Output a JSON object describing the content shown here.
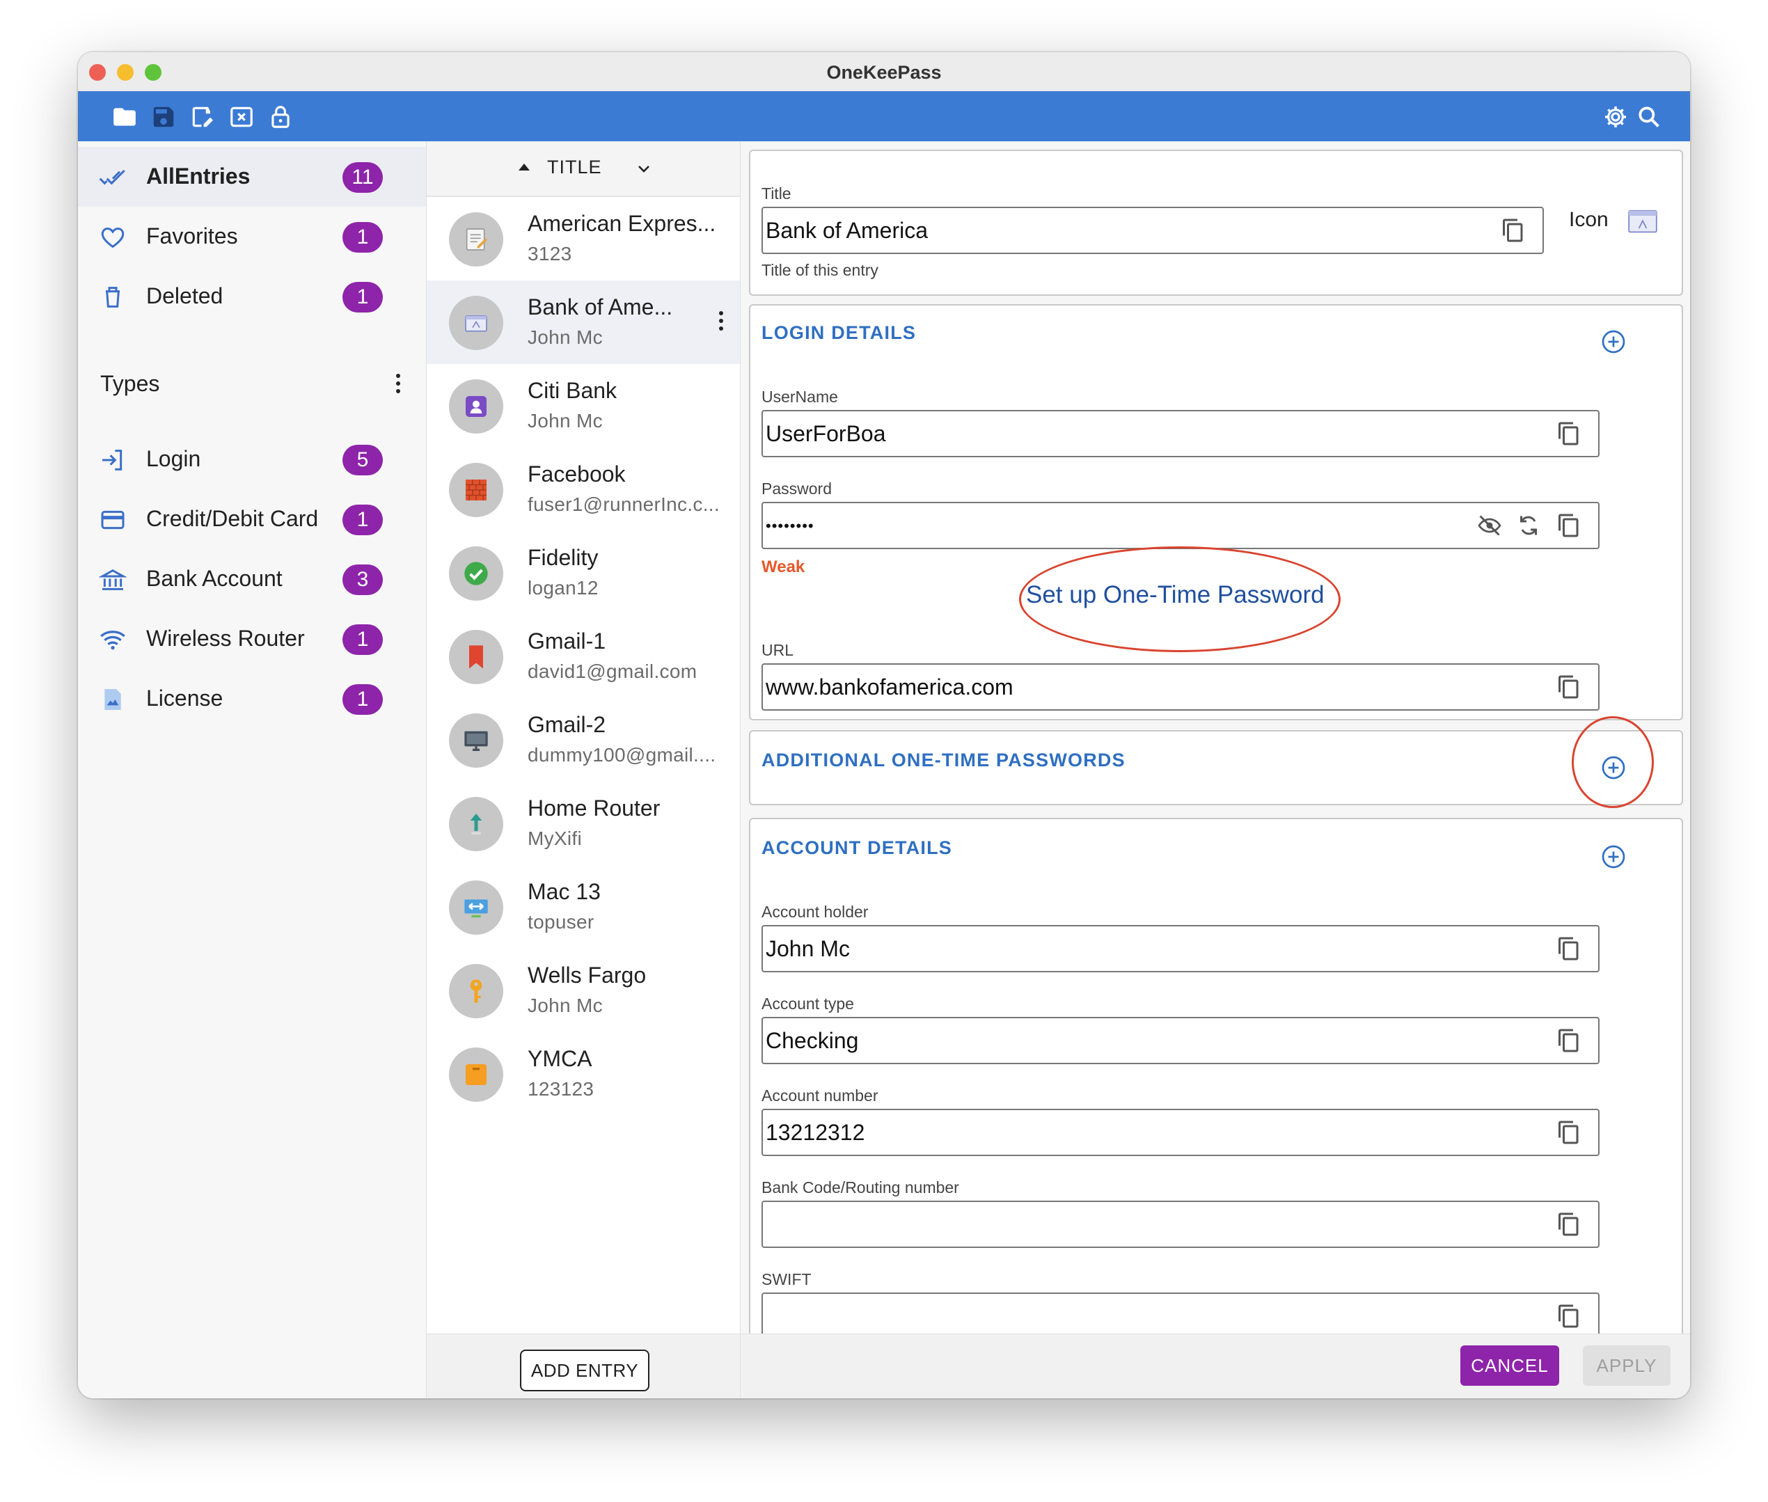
{
  "window": {
    "title": "OneKeePass"
  },
  "colors": {
    "toolbar": "#3b7bd4",
    "badge": "#8e24aa",
    "section_title": "#2f6fc1",
    "weak": "#e6582a",
    "annotation": "#d9442f"
  },
  "toolbar": {
    "left_icons": [
      "folder-open-icon",
      "save-icon",
      "save-as-icon",
      "close-database-icon",
      "lock-icon"
    ],
    "right_icons": [
      "settings-icon",
      "search-icon"
    ]
  },
  "sidebar": {
    "items": [
      {
        "label": "AllEntries",
        "count": "11",
        "icon": "double-check-icon"
      },
      {
        "label": "Favorites",
        "count": "1",
        "icon": "heart-icon"
      },
      {
        "label": "Deleted",
        "count": "1",
        "icon": "trash-icon"
      }
    ],
    "types_label": "Types",
    "types": [
      {
        "label": "Login",
        "count": "5",
        "icon": "login-icon"
      },
      {
        "label": "Credit/Debit Card",
        "count": "1",
        "icon": "credit-card-icon"
      },
      {
        "label": "Bank Account",
        "count": "3",
        "icon": "bank-icon"
      },
      {
        "label": "Wireless Router",
        "count": "1",
        "icon": "wifi-icon"
      },
      {
        "label": "License",
        "count": "1",
        "icon": "license-icon"
      }
    ]
  },
  "list": {
    "sort_label": "TITLE",
    "entries": [
      {
        "title": "American Expres...",
        "subtitle": "3123",
        "icon": "notepad-icon"
      },
      {
        "title": "Bank of Ame...",
        "subtitle": "John Mc",
        "icon": "bank-screen-icon"
      },
      {
        "title": "Citi Bank",
        "subtitle": "John Mc",
        "icon": "contact-card-icon"
      },
      {
        "title": "Facebook",
        "subtitle": "fuser1@runnerInc.c...",
        "icon": "brick-wall-icon"
      },
      {
        "title": "Fidelity",
        "subtitle": "logan12",
        "icon": "check-circle-icon"
      },
      {
        "title": "Gmail-1",
        "subtitle": "david1@gmail.com",
        "icon": "bookmark-icon"
      },
      {
        "title": "Gmail-2",
        "subtitle": "dummy100@gmail....",
        "icon": "monitor-icon"
      },
      {
        "title": "Home Router",
        "subtitle": "MyXifi",
        "icon": "router-arrow-icon"
      },
      {
        "title": "Mac 13",
        "subtitle": "topuser",
        "icon": "transfer-icon"
      },
      {
        "title": "Wells Fargo",
        "subtitle": "John Mc",
        "icon": "key-icon"
      },
      {
        "title": "YMCA",
        "subtitle": "123123",
        "icon": "folder-note-icon"
      }
    ],
    "add_entry_label": "ADD ENTRY"
  },
  "detail": {
    "title_field": {
      "label": "Title",
      "value": "Bank of America",
      "helper": "Title of this entry"
    },
    "icon_label": "Icon",
    "login_section": {
      "title": "LOGIN DETAILS",
      "username_label": "UserName",
      "username_value": "UserForBoa",
      "password_label": "Password",
      "password_value": "••••••••",
      "strength": "Weak",
      "otp_link": "Set up One-Time Password",
      "url_label": "URL",
      "url_value": "www.bankofamerica.com"
    },
    "otp_section": {
      "title": "ADDITIONAL ONE-TIME PASSWORDS"
    },
    "account_section": {
      "title": "ACCOUNT DETAILS",
      "holder_label": "Account holder",
      "holder_value": "John Mc",
      "type_label": "Account type",
      "type_value": "Checking",
      "number_label": "Account number",
      "number_value": "13212312",
      "routing_label": "Bank Code/Routing number",
      "routing_value": "",
      "swift_label": "SWIFT",
      "swift_value": ""
    },
    "cancel_label": "CANCEL",
    "apply_label": "APPLY"
  }
}
